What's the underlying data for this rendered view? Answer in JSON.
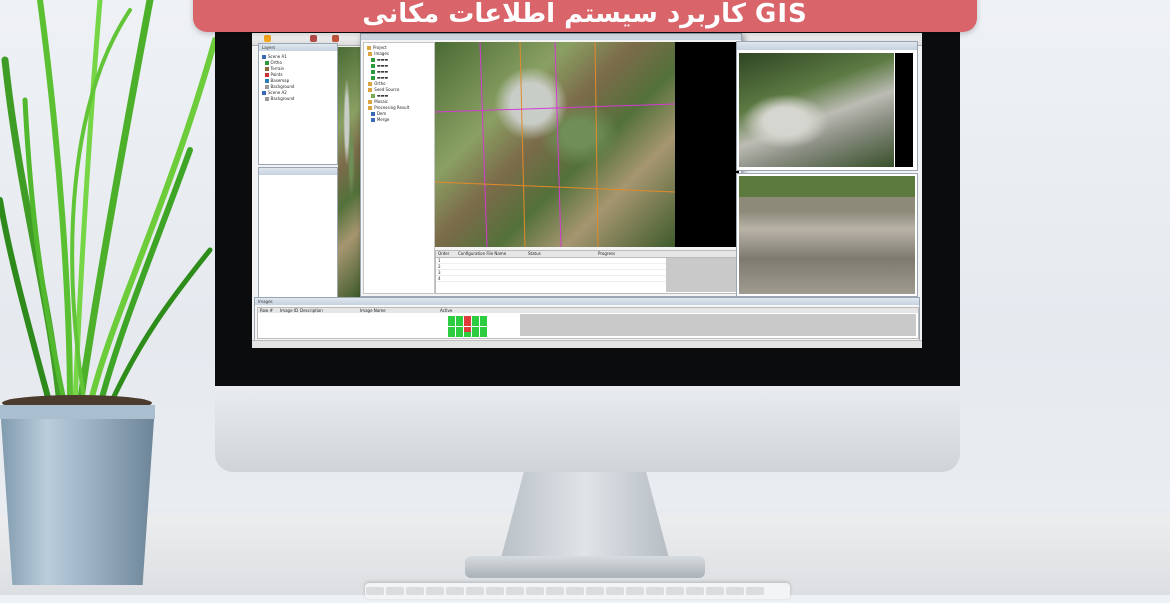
{
  "banner": {
    "title": "کاربرد سیستم اطلاعات مکانی GIS"
  },
  "screen": {
    "left_tree": [
      "Layers",
      "Scene A1",
      "Ortho",
      "Terrain",
      "Points",
      "Basemap",
      "Background",
      "Scene A2",
      "Background"
    ],
    "project_tree": [
      "Project",
      "Images",
      "Ortho",
      "Seed Source",
      "Mosaic",
      "Processing Result",
      "Dem",
      "Merge"
    ],
    "table_headers": [
      "Order",
      "Configuration File Name",
      "Status",
      "Progress"
    ],
    "table_rows": [
      [
        "1",
        "",
        "",
        ""
      ],
      [
        "2",
        "",
        "",
        ""
      ],
      [
        "3",
        "",
        "",
        ""
      ],
      [
        "4",
        "",
        "",
        ""
      ]
    ],
    "images_panel_title": "Images",
    "images_headers": [
      "Row #",
      "Image ID",
      "Description",
      "Image Name",
      "Active"
    ]
  },
  "colors": {
    "banner": "#d9646a",
    "grass": "#4caf2a",
    "pot": "#9fb6c8"
  }
}
